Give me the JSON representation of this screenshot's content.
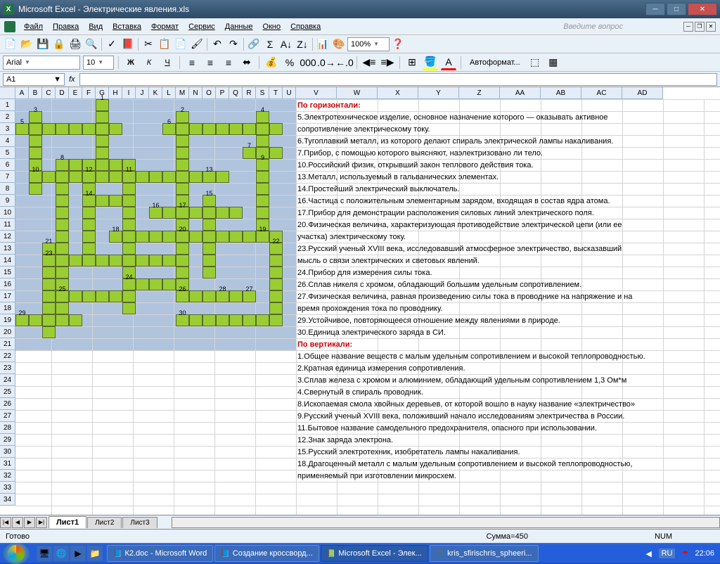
{
  "window": {
    "title": "Microsoft Excel - Электрические явления.xls"
  },
  "menu": {
    "file": "Файл",
    "edit": "Правка",
    "view": "Вид",
    "insert": "Вставка",
    "format": "Формат",
    "tools": "Сервис",
    "data": "Данные",
    "window": "Окно",
    "help": "Справка",
    "question": "Введите вопрос"
  },
  "font": {
    "name": "Arial",
    "size": "10",
    "autoformat": "Автоформат..."
  },
  "zoom": "100%",
  "cell": {
    "ref": "A1",
    "fx": "fx"
  },
  "cols_narrow": [
    "A",
    "B",
    "C",
    "D",
    "E",
    "F",
    "G",
    "H",
    "I",
    "J",
    "K",
    "L",
    "M",
    "N",
    "O",
    "P",
    "Q",
    "R",
    "S",
    "T",
    "U"
  ],
  "cols_wide": [
    "V",
    "W",
    "X",
    "Y",
    "Z",
    "AA",
    "AB",
    "AC",
    "AD"
  ],
  "rows": [
    "1",
    "2",
    "3",
    "4",
    "5",
    "6",
    "7",
    "8",
    "9",
    "10",
    "11",
    "12",
    "13",
    "14",
    "15",
    "16",
    "17",
    "18",
    "19",
    "20",
    "21",
    "22",
    "23",
    "24",
    "25",
    "26",
    "27",
    "28",
    "29",
    "30",
    "31",
    "32",
    "33",
    "34"
  ],
  "clues": [
    {
      "t": "По горизонтали:",
      "hd": true
    },
    {
      "t": "5.Электротехническое изделие, основное назначение которого — оказывать активное"
    },
    {
      "t": "сопротивление электрическому току."
    },
    {
      "t": "6.Тугоплавкий металл, из которого делают спираль электрической лампы накаливания."
    },
    {
      "t": "7.Прибор, с помощью которого выясняют, наэлектризовано ли тело."
    },
    {
      "t": "10.Российский физик, открывший закон теплового действия тока."
    },
    {
      "t": "13.Металл, используемый в гальванических элементах."
    },
    {
      "t": "14.Простейший электрический выключатель."
    },
    {
      "t": "16.Частица с положительным элементарным зарядом, входящая в состав ядра атома."
    },
    {
      "t": "17.Прибор для демонстрации расположения силовых линий электрического поля."
    },
    {
      "t": "20.Физическая величина, характеризующая противодействие электрической цепи (или ее"
    },
    {
      "t": "участка) электрическому току."
    },
    {
      "t": "23.Русский ученый XVIII века, исследовавший атмосферное электричество, высказавший"
    },
    {
      "t": "мысль о связи электрических и световых явлений."
    },
    {
      "t": "24.Прибор для измерения силы тока."
    },
    {
      "t": "26.Сплав никеля с хромом, обладающий большим удельным сопротивлением."
    },
    {
      "t": "27.Физическая величина, равная произведению силы тока в проводнике на напряжение и на"
    },
    {
      "t": "время прохождения тока по проводнику."
    },
    {
      "t": "29.Устойчивое, повторяющееся отношение между явлениями в природе."
    },
    {
      "t": "30.Единица электрического заряда в СИ."
    },
    {
      "t": "По вертикали:",
      "hd": true
    },
    {
      "t": "1.Общее название веществ с малым удельным сопротивлением и высокой теплопроводностью."
    },
    {
      "t": "2.Кратная единица измерения сопротивления."
    },
    {
      "t": "3.Сплав железа с хромом и алюминием, обладающий удельным сопротивлением 1,3 Ом*м"
    },
    {
      "t": "4.Свернутый в спираль проводник."
    },
    {
      "t": "8.Ископаемая смола хвойных деревьев, от которой вошло в науку название «электричество»"
    },
    {
      "t": "9.Русский ученый XVIII века, положивший начало исследованиям электричества в России."
    },
    {
      "t": "11.Бытовое название самодельного предохранителя, опасного при использовании."
    },
    {
      "t": "12.Знак заряда электрона."
    },
    {
      "t": "15.Русский электротехник, изобретатель лампы накаливания."
    },
    {
      "t": "18.Драгоценный металл с малым удельным сопротивлением и высокой теплопроводностью,"
    },
    {
      "t": "применяемый при изготовлении микросхем."
    },
    {
      "t": ""
    }
  ],
  "crossword_cells": [
    [
      1,
      7
    ],
    [
      2,
      2
    ],
    [
      2,
      7
    ],
    [
      2,
      13
    ],
    [
      2,
      19
    ],
    [
      3,
      1
    ],
    [
      3,
      2
    ],
    [
      3,
      3
    ],
    [
      3,
      4
    ],
    [
      3,
      5
    ],
    [
      3,
      6
    ],
    [
      3,
      7
    ],
    [
      3,
      8
    ],
    [
      3,
      12
    ],
    [
      3,
      13
    ],
    [
      3,
      14
    ],
    [
      3,
      15
    ],
    [
      3,
      16
    ],
    [
      3,
      17
    ],
    [
      3,
      18
    ],
    [
      3,
      19
    ],
    [
      3,
      20
    ],
    [
      4,
      2
    ],
    [
      4,
      7
    ],
    [
      4,
      13
    ],
    [
      4,
      19
    ],
    [
      5,
      2
    ],
    [
      5,
      7
    ],
    [
      5,
      13
    ],
    [
      5,
      18
    ],
    [
      5,
      19
    ],
    [
      5,
      20
    ],
    [
      6,
      2
    ],
    [
      6,
      4
    ],
    [
      6,
      5
    ],
    [
      6,
      6
    ],
    [
      6,
      7
    ],
    [
      6,
      8
    ],
    [
      6,
      9
    ],
    [
      6,
      13
    ],
    [
      6,
      19
    ],
    [
      7,
      2
    ],
    [
      7,
      3
    ],
    [
      7,
      4
    ],
    [
      7,
      5
    ],
    [
      7,
      6
    ],
    [
      7,
      7
    ],
    [
      7,
      8
    ],
    [
      7,
      9
    ],
    [
      7,
      10
    ],
    [
      7,
      11
    ],
    [
      7,
      12
    ],
    [
      7,
      13
    ],
    [
      7,
      14
    ],
    [
      7,
      15
    ],
    [
      7,
      16
    ],
    [
      7,
      19
    ],
    [
      8,
      2
    ],
    [
      8,
      4
    ],
    [
      8,
      6
    ],
    [
      8,
      9
    ],
    [
      8,
      13
    ],
    [
      8,
      19
    ],
    [
      9,
      4
    ],
    [
      9,
      6
    ],
    [
      9,
      7
    ],
    [
      9,
      8
    ],
    [
      9,
      9
    ],
    [
      9,
      13
    ],
    [
      9,
      15
    ],
    [
      9,
      19
    ],
    [
      10,
      4
    ],
    [
      10,
      6
    ],
    [
      10,
      9
    ],
    [
      10,
      11
    ],
    [
      10,
      12
    ],
    [
      10,
      13
    ],
    [
      10,
      14
    ],
    [
      10,
      15
    ],
    [
      10,
      16
    ],
    [
      10,
      17
    ],
    [
      10,
      19
    ],
    [
      11,
      4
    ],
    [
      11,
      6
    ],
    [
      11,
      9
    ],
    [
      11,
      13
    ],
    [
      11,
      15
    ],
    [
      11,
      19
    ],
    [
      12,
      4
    ],
    [
      12,
      6
    ],
    [
      12,
      8
    ],
    [
      12,
      9
    ],
    [
      12,
      10
    ],
    [
      12,
      11
    ],
    [
      12,
      12
    ],
    [
      12,
      13
    ],
    [
      12,
      14
    ],
    [
      12,
      15
    ],
    [
      12,
      16
    ],
    [
      12,
      17
    ],
    [
      12,
      18
    ],
    [
      12,
      19
    ],
    [
      12,
      20
    ],
    [
      13,
      3
    ],
    [
      13,
      4
    ],
    [
      13,
      6
    ],
    [
      13,
      9
    ],
    [
      13,
      13
    ],
    [
      13,
      15
    ],
    [
      13,
      20
    ],
    [
      14,
      3
    ],
    [
      14,
      4
    ],
    [
      14,
      5
    ],
    [
      14,
      6
    ],
    [
      14,
      7
    ],
    [
      14,
      8
    ],
    [
      14,
      9
    ],
    [
      14,
      10
    ],
    [
      14,
      11
    ],
    [
      14,
      12
    ],
    [
      14,
      13
    ],
    [
      14,
      15
    ],
    [
      14,
      20
    ],
    [
      15,
      3
    ],
    [
      15,
      4
    ],
    [
      15,
      9
    ],
    [
      15,
      13
    ],
    [
      15,
      15
    ],
    [
      15,
      20
    ],
    [
      16,
      3
    ],
    [
      16,
      4
    ],
    [
      16,
      9
    ],
    [
      16,
      10
    ],
    [
      16,
      11
    ],
    [
      16,
      12
    ],
    [
      16,
      13
    ],
    [
      16,
      20
    ],
    [
      17,
      3
    ],
    [
      17,
      4
    ],
    [
      17,
      5
    ],
    [
      17,
      6
    ],
    [
      17,
      7
    ],
    [
      17,
      8
    ],
    [
      17,
      9
    ],
    [
      17,
      13
    ],
    [
      17,
      14
    ],
    [
      17,
      15
    ],
    [
      17,
      16
    ],
    [
      17,
      17
    ],
    [
      17,
      18
    ],
    [
      17,
      20
    ],
    [
      18,
      3
    ],
    [
      18,
      4
    ],
    [
      18,
      9
    ],
    [
      18,
      20
    ],
    [
      19,
      1
    ],
    [
      19,
      2
    ],
    [
      19,
      3
    ],
    [
      19,
      4
    ],
    [
      19,
      5
    ],
    [
      19,
      13
    ],
    [
      19,
      14
    ],
    [
      19,
      15
    ],
    [
      19,
      16
    ],
    [
      19,
      17
    ],
    [
      19,
      18
    ],
    [
      19,
      19
    ],
    [
      19,
      20
    ],
    [
      20,
      3
    ]
  ],
  "crossword_nums": [
    {
      "r": 1,
      "c": 7,
      "n": "1"
    },
    {
      "r": 2,
      "c": 13,
      "n": "2"
    },
    {
      "r": 2,
      "c": 2,
      "n": "3"
    },
    {
      "r": 2,
      "c": 19,
      "n": "4"
    },
    {
      "r": 3,
      "c": 1,
      "n": "5"
    },
    {
      "r": 3,
      "c": 12,
      "n": "6"
    },
    {
      "r": 5,
      "c": 18,
      "n": "7"
    },
    {
      "r": 6,
      "c": 4,
      "n": "8"
    },
    {
      "r": 6,
      "c": 19,
      "n": "9"
    },
    {
      "r": 7,
      "c": 2,
      "n": "10"
    },
    {
      "r": 7,
      "c": 9,
      "n": "11"
    },
    {
      "r": 7,
      "c": 6,
      "n": "12"
    },
    {
      "r": 7,
      "c": 15,
      "n": "13"
    },
    {
      "r": 9,
      "c": 6,
      "n": "14"
    },
    {
      "r": 9,
      "c": 15,
      "n": "15"
    },
    {
      "r": 10,
      "c": 11,
      "n": "16"
    },
    {
      "r": 10,
      "c": 13,
      "n": "17"
    },
    {
      "r": 12,
      "c": 8,
      "n": "18"
    },
    {
      "r": 12,
      "c": 19,
      "n": "19"
    },
    {
      "r": 12,
      "c": 13,
      "n": "20"
    },
    {
      "r": 13,
      "c": 3,
      "n": "21"
    },
    {
      "r": 13,
      "c": 20,
      "n": "22"
    },
    {
      "r": 14,
      "c": 3,
      "n": "23"
    },
    {
      "r": 16,
      "c": 9,
      "n": "24"
    },
    {
      "r": 17,
      "c": 4,
      "n": "25"
    },
    {
      "r": 17,
      "c": 13,
      "n": "26"
    },
    {
      "r": 17,
      "c": 18,
      "n": "27"
    },
    {
      "r": 17,
      "c": 16,
      "n": "28"
    },
    {
      "r": 19,
      "c": 1,
      "n": "29"
    },
    {
      "r": 19,
      "c": 13,
      "n": "30"
    }
  ],
  "tabs": {
    "t1": "Лист1",
    "t2": "Лист2",
    "t3": "Лист3"
  },
  "status": {
    "ready": "Готово",
    "sum": "Сумма=450",
    "num": "NUM"
  },
  "tasks": {
    "t1": "К2.doc - Microsoft Word",
    "t2": "Создание кроссворд...",
    "t3": "Microsoft Excel - Элек...",
    "t4": "kris_sfirischris_spheeri..."
  },
  "tray": {
    "lang": "RU",
    "time": "22:06"
  }
}
